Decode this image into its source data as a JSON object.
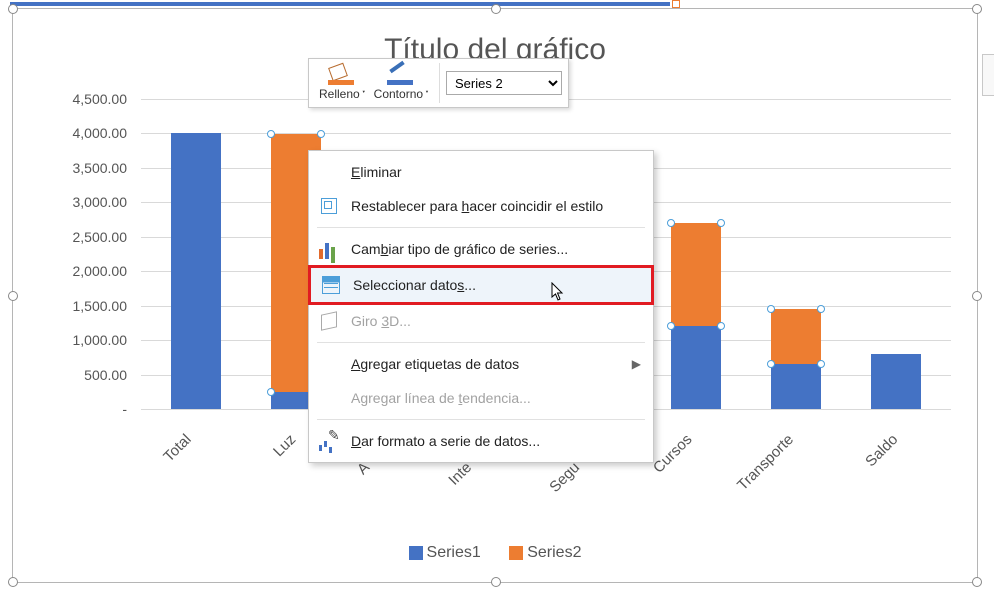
{
  "chart_data": {
    "type": "bar",
    "title": "Título del gráfico",
    "categories": [
      "Total",
      "Luz",
      "Agua",
      "Internet",
      "Seguros",
      "Cursos",
      "Transporte",
      "Saldo"
    ],
    "series": [
      {
        "name": "Series1",
        "color": "#4472c4",
        "values": [
          4000,
          250,
          0,
          0,
          0,
          1200,
          650,
          800
        ]
      },
      {
        "name": "Series2",
        "color": "#ed7d31",
        "values": [
          0,
          3750,
          0,
          0,
          0,
          1500,
          800,
          0
        ]
      }
    ],
    "ylabel": "",
    "xlabel": "",
    "ylim": [
      0,
      4500
    ],
    "y_ticks": [
      "-",
      "500.00",
      "1,000.00",
      "1,500.00",
      "2,000.00",
      "2,500.00",
      "3,000.00",
      "3,500.00",
      "4,000.00",
      "4,500.00"
    ]
  },
  "legend": {
    "s1": "Series1",
    "s2": "Series2"
  },
  "mini_toolbar": {
    "fill": "Relleno",
    "outline": "Contorno",
    "series_selected": "Series 2"
  },
  "context_menu": {
    "delete": "Eliminar",
    "reset": "Restablecer para hacer coincidir el estilo",
    "change_type": "Cambiar tipo de gráfico de series...",
    "select_data": "Seleccionar datos...",
    "giro3d": "Giro 3D...",
    "add_labels": "Agregar etiquetas de datos",
    "add_trend": "Agregar línea de tendencia...",
    "format_series": "Dar formato a serie de datos..."
  }
}
